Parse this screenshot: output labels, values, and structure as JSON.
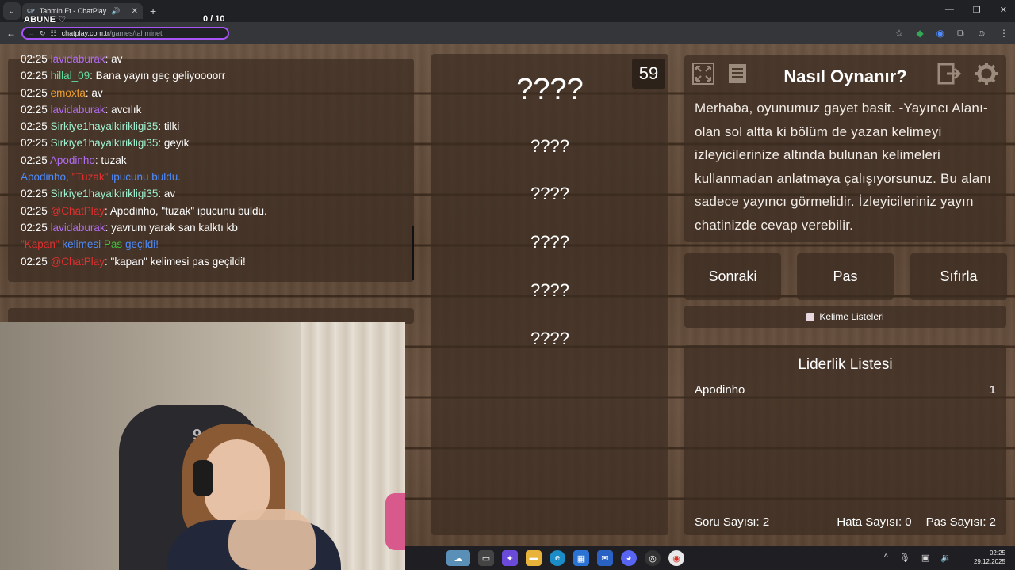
{
  "browser": {
    "tab_title": "Tahmin Et - ChatPlay",
    "tab_favicon": "CP",
    "overlay_abune": "ABUNE ♡",
    "overlay_counter": "0  / 10",
    "url_host": "chatplay.com.tr",
    "url_path": "/games/tahminet"
  },
  "chat": {
    "lines": [
      {
        "ts": "02:25",
        "user": "lavidaburak",
        "color": "#b36cf5",
        "msg": ": av"
      },
      {
        "ts": "02:25",
        "user": "hillal_09",
        "color": "#5fe0a0",
        "msg": ": Bana yayın geç geliyoooorr"
      },
      {
        "ts": "02:25",
        "user": "emoxta",
        "color": "#f0a030",
        "msg": ": av"
      },
      {
        "ts": "02:25",
        "user": "lavidaburak",
        "color": "#b36cf5",
        "msg": ": avcılık"
      },
      {
        "ts": "02:25",
        "user": "Sirkiye1hayalkirikligi35",
        "color": "#a0f0d0",
        "msg": ": tilki"
      },
      {
        "ts": "02:25",
        "user": "Sirkiye1hayalkirikligi35",
        "color": "#a0f0d0",
        "msg": ": geyik"
      },
      {
        "ts": "02:25",
        "user": "Apodinho",
        "color": "#b36cf5",
        "msg": ": tuzak"
      },
      {
        "ts": "",
        "user": "",
        "color": "",
        "msg": ""
      },
      {
        "ts": "02:25",
        "user": "Sirkiye1hayalkirikligi35",
        "color": "#a0f0d0",
        "msg": ": av"
      },
      {
        "ts": "02:25",
        "user": "@ChatPlay",
        "color": "#e03030",
        "msg": ": Apodinho, \"tuzak\" ipucunu buldu."
      },
      {
        "ts": "02:25",
        "user": "lavidaburak",
        "color": "#b36cf5",
        "msg": ": yavrum yarak san kalktı kb"
      },
      {
        "ts": "",
        "user": "",
        "color": "",
        "msg": ""
      },
      {
        "ts": "02:25",
        "user": "@ChatPlay",
        "color": "#e03030",
        "msg": ": \"kapan\" kelimesi pas geçildi!"
      }
    ],
    "system_clue": {
      "who": "Apodinho,",
      "word": "\"Tuzak\"",
      "rest": "ipucunu buldu."
    },
    "system_pass": {
      "word": "\"Kapan\"",
      "kelimesi": "kelimesi",
      "pas": "Pas",
      "gecildi": "geçildi!"
    }
  },
  "words": {
    "timer": "59",
    "main": "????",
    "items": [
      "????",
      "????",
      "????",
      "????",
      "????"
    ]
  },
  "howto": {
    "title": "Nasıl Oynanır?",
    "text": "Merhaba, oyunumuz gayet basit. -Yayıncı Alanı-olan sol altta ki bölüm de yazan kelimeyi izleyicilerinize altında bulunan kelimeleri kullanmadan anlatmaya çalışıyorsunuz. Bu alanı sadece yayıncı görmelidir. İzleyicileriniz yayın chatinizde cevap verebilir."
  },
  "buttons": {
    "next": "Sonraki",
    "pass": "Pas",
    "reset": "Sıfırla",
    "word_lists": "Kelime Listeleri"
  },
  "leaderboard": {
    "title": "Liderlik Listesi",
    "rows": [
      {
        "name": "Apodinho",
        "score": "1"
      }
    ]
  },
  "stats": {
    "questions": "Soru Sayısı: 2",
    "errors": "Hata Sayısı: 0",
    "passes": "Pas Sayısı: 2"
  },
  "webcam": {
    "chair_number": "9"
  },
  "taskbar": {
    "time": "02:25",
    "date": "29.12.2025"
  }
}
